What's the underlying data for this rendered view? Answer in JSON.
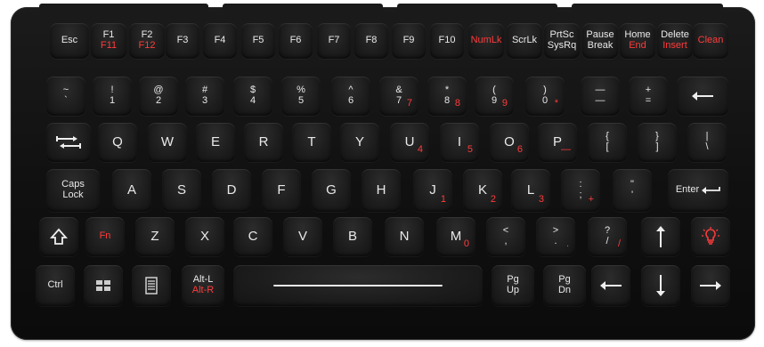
{
  "row1": [
    {
      "name": "esc-key",
      "top": "Esc"
    },
    {
      "name": "f1-key",
      "top": "F1",
      "bottom": "F11"
    },
    {
      "name": "f2-key",
      "top": "F2",
      "bottom": "F12"
    },
    {
      "name": "f3-key",
      "top": "F3"
    },
    {
      "name": "f4-key",
      "top": "F4"
    },
    {
      "name": "f5-key",
      "top": "F5"
    },
    {
      "name": "f6-key",
      "top": "F6"
    },
    {
      "name": "f7-key",
      "top": "F7"
    },
    {
      "name": "f8-key",
      "top": "F8"
    },
    {
      "name": "f9-key",
      "top": "F9"
    },
    {
      "name": "f10-key",
      "top": "F10"
    },
    {
      "name": "numlk-key",
      "top": "NumLk",
      "red": true
    },
    {
      "name": "scrlk-key",
      "top": "ScrLk"
    },
    {
      "name": "prtsc-key",
      "top": "PrtSc",
      "bottom": "SysRq",
      "bottom_white": true
    },
    {
      "name": "pause-key",
      "top": "Pause",
      "bottom": "Break",
      "bottom_white": true
    },
    {
      "name": "home-key",
      "top": "Home",
      "bottom": "End"
    },
    {
      "name": "delete-key",
      "top": "Delete",
      "bottom": "Insert"
    },
    {
      "name": "clean-key",
      "top": "Clean",
      "red": true
    }
  ],
  "row2": [
    {
      "name": "tilde-key",
      "top": "~",
      "bottom": "`"
    },
    {
      "name": "key-1",
      "top": "!",
      "bottom": "1"
    },
    {
      "name": "key-2",
      "top": "@",
      "bottom": "2"
    },
    {
      "name": "key-3",
      "top": "#",
      "bottom": "3"
    },
    {
      "name": "key-4",
      "top": "$",
      "bottom": "4"
    },
    {
      "name": "key-5",
      "top": "%",
      "bottom": "5"
    },
    {
      "name": "key-6",
      "top": "^",
      "bottom": "6"
    },
    {
      "name": "key-7",
      "top": "&",
      "bottom": "7",
      "numpad": "7"
    },
    {
      "name": "key-8",
      "top": "*",
      "bottom": "8",
      "numpad": "8"
    },
    {
      "name": "key-9",
      "top": "(",
      "bottom": "9",
      "numpad": "9"
    },
    {
      "name": "key-0",
      "top": ")",
      "bottom": "0",
      "numpad": "*"
    },
    {
      "name": "minus-key",
      "top": "—",
      "bottom": "—"
    },
    {
      "name": "equals-key",
      "top": "+",
      "bottom": "="
    },
    {
      "name": "backspace-key",
      "icon": "arrow-left-icon"
    }
  ],
  "row3": [
    {
      "name": "tab-key",
      "icon": "tab-icon"
    },
    {
      "name": "key-q",
      "top": "Q"
    },
    {
      "name": "key-w",
      "top": "W"
    },
    {
      "name": "key-e",
      "top": "E"
    },
    {
      "name": "key-r",
      "top": "R"
    },
    {
      "name": "key-t",
      "top": "T"
    },
    {
      "name": "key-y",
      "top": "Y"
    },
    {
      "name": "key-u",
      "top": "U",
      "numpad": "4"
    },
    {
      "name": "key-i",
      "top": "I",
      "numpad": "5"
    },
    {
      "name": "key-o",
      "top": "O",
      "numpad": "6"
    },
    {
      "name": "key-p",
      "top": "P",
      "numpad": "—"
    },
    {
      "name": "lbracket-key",
      "top": "{",
      "bottom": "["
    },
    {
      "name": "rbracket-key",
      "top": "}",
      "bottom": "]"
    },
    {
      "name": "backslash-key",
      "top": "|",
      "bottom": "\\"
    }
  ],
  "row4": [
    {
      "name": "capslock-key",
      "top": "Caps",
      "bottom": "Lock",
      "bottom_white": true
    },
    {
      "name": "key-a",
      "top": "A"
    },
    {
      "name": "key-s",
      "top": "S"
    },
    {
      "name": "key-d",
      "top": "D"
    },
    {
      "name": "key-f",
      "top": "F"
    },
    {
      "name": "key-g",
      "top": "G"
    },
    {
      "name": "key-h",
      "top": "H"
    },
    {
      "name": "key-j",
      "top": "J",
      "numpad": "1"
    },
    {
      "name": "key-k",
      "top": "K",
      "numpad": "2"
    },
    {
      "name": "key-l",
      "top": "L",
      "numpad": "3"
    },
    {
      "name": "semicolon-key",
      "top": ":",
      "bottom": ";",
      "numpad": "+"
    },
    {
      "name": "quote-key",
      "top": "\"",
      "bottom": "'"
    },
    {
      "name": "enter-key",
      "top": "Enter",
      "icon": "enter-icon"
    }
  ],
  "row5": [
    {
      "name": "shift-key",
      "icon": "shift-icon"
    },
    {
      "name": "fn-key",
      "top": "Fn",
      "red": true
    },
    {
      "name": "key-z",
      "top": "Z"
    },
    {
      "name": "key-x",
      "top": "X"
    },
    {
      "name": "key-c",
      "top": "C"
    },
    {
      "name": "key-v",
      "top": "V"
    },
    {
      "name": "key-b",
      "top": "B"
    },
    {
      "name": "key-n",
      "top": "N"
    },
    {
      "name": "key-m",
      "top": "M",
      "numpad": "0"
    },
    {
      "name": "comma-key",
      "top": "<",
      "bottom": ","
    },
    {
      "name": "period-key",
      "top": ">",
      "bottom": ".",
      "numpad": "."
    },
    {
      "name": "slash-key",
      "top": "?",
      "bottom": "/",
      "numpad": "/"
    },
    {
      "name": "up-arrow-key",
      "icon": "arrow-up-icon"
    },
    {
      "name": "backlight-key",
      "icon": "backlight-icon"
    }
  ],
  "row6": [
    {
      "name": "ctrl-key",
      "top": "Ctrl"
    },
    {
      "name": "windows-key",
      "icon": "windows-icon"
    },
    {
      "name": "menu-key",
      "icon": "menu-icon"
    },
    {
      "name": "alt-key",
      "top": "Alt-L",
      "bottom": "Alt-R"
    },
    {
      "name": "space-key",
      "icon": "spacebar-line"
    },
    {
      "name": "pgup-key",
      "top": "Pg",
      "bottom": "Up",
      "bottom_white": true
    },
    {
      "name": "pgdn-key",
      "top": "Pg",
      "bottom": "Dn",
      "bottom_white": true
    },
    {
      "name": "left-arrow-key",
      "icon": "arrow-left-icon"
    },
    {
      "name": "down-arrow-key",
      "icon": "arrow-down-icon"
    },
    {
      "name": "right-arrow-key",
      "icon": "arrow-right-icon"
    }
  ],
  "colors": {
    "legend": "#e9e9e9",
    "fn_legend": "#ff3b3b",
    "key": "#1d1d1d",
    "body": "#111111"
  }
}
